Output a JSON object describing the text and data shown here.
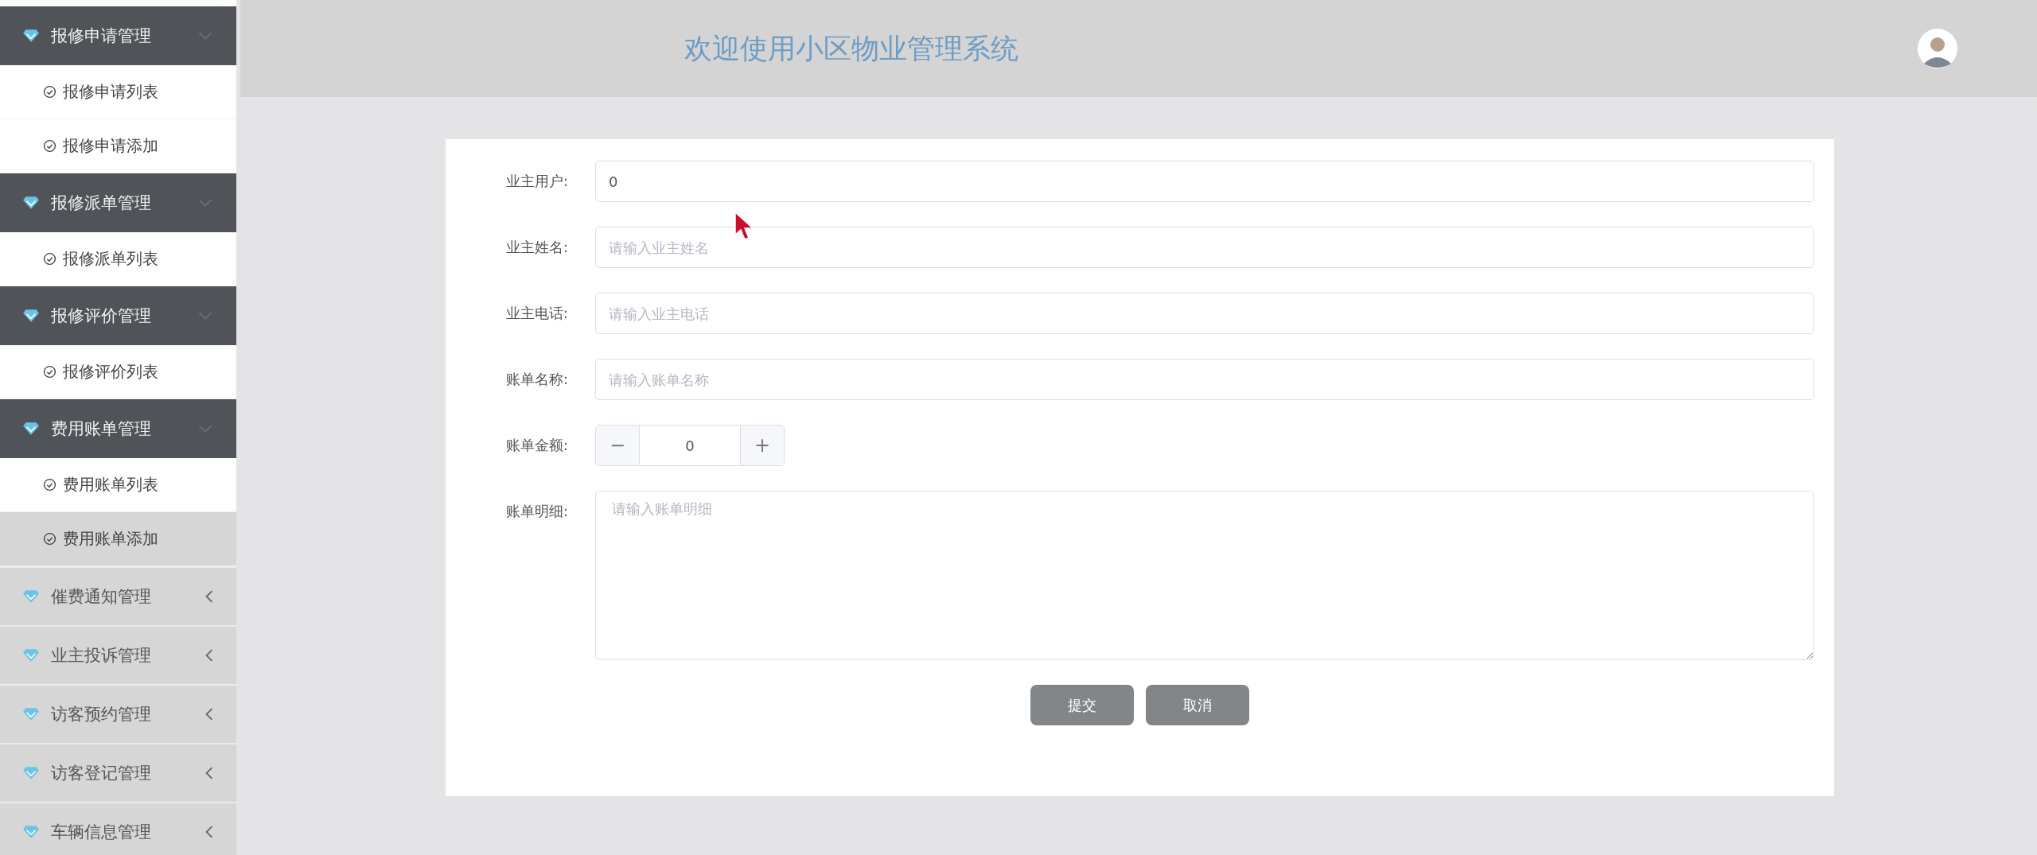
{
  "sidebar": {
    "groups": [
      {
        "label": "报修申请管理",
        "expanded": true,
        "children": [
          {
            "label": "报修申请列表",
            "selected": false
          },
          {
            "label": "报修申请添加",
            "selected": false
          }
        ]
      },
      {
        "label": "报修派单管理",
        "expanded": true,
        "children": [
          {
            "label": "报修派单列表",
            "selected": false
          }
        ]
      },
      {
        "label": "报修评价管理",
        "expanded": true,
        "children": [
          {
            "label": "报修评价列表",
            "selected": false
          }
        ]
      },
      {
        "label": "费用账单管理",
        "expanded": true,
        "children": [
          {
            "label": "费用账单列表",
            "selected": false
          },
          {
            "label": "费用账单添加",
            "selected": true
          }
        ]
      },
      {
        "label": "催费通知管理",
        "expanded": false
      },
      {
        "label": "业主投诉管理",
        "expanded": false
      },
      {
        "label": "访客预约管理",
        "expanded": false
      },
      {
        "label": "访客登记管理",
        "expanded": false
      },
      {
        "label": "车辆信息管理",
        "expanded": false
      }
    ]
  },
  "header": {
    "title": "欢迎使用小区物业管理系统"
  },
  "form": {
    "fields": [
      {
        "kind": "text",
        "label": "业主用户:",
        "value": "0"
      },
      {
        "kind": "text",
        "label": "业主姓名:",
        "placeholder": "请输入业主姓名"
      },
      {
        "kind": "text",
        "label": "业主电话:",
        "placeholder": "请输入业主电话"
      },
      {
        "kind": "text",
        "label": "账单名称:",
        "placeholder": "请输入账单名称"
      },
      {
        "kind": "number",
        "label": "账单金额:",
        "value": "0",
        "decrement": "−",
        "increment": "+"
      },
      {
        "kind": "textarea",
        "label": "账单明细:",
        "placeholder": "请输入账单明细"
      }
    ],
    "buttons": [
      {
        "label": "提交"
      },
      {
        "label": "取消"
      }
    ]
  }
}
